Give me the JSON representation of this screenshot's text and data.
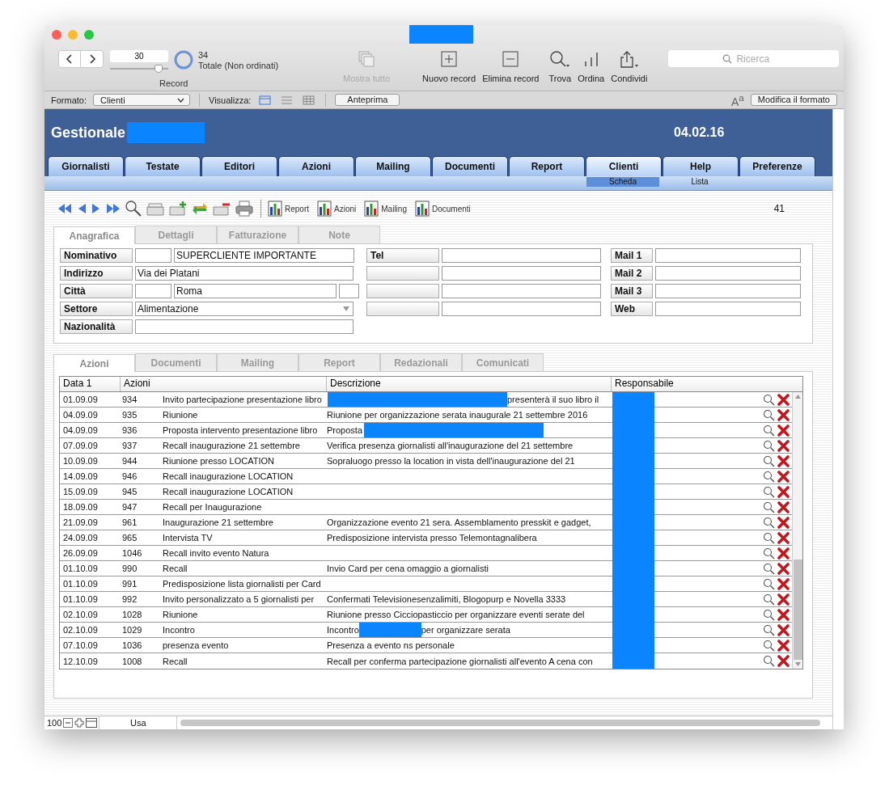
{
  "toolbar": {
    "record_value": "30",
    "record_slider": {
      "level": 0.83
    },
    "record_label": "Record",
    "found_count": "34",
    "found_label": "Totale (Non ordinati)",
    "tools": [
      {
        "kind": "show-all",
        "label": "Mostra tutto",
        "disabled": true
      },
      {
        "kind": "new",
        "label": "Nuovo record",
        "disabled": false
      },
      {
        "kind": "delete",
        "label": "Elimina record",
        "disabled": false
      },
      {
        "kind": "find",
        "label": "Trova",
        "disabled": false
      },
      {
        "kind": "sort",
        "label": "Ordina",
        "disabled": false
      },
      {
        "kind": "share",
        "label": "Condividi",
        "disabled": false
      }
    ],
    "search": {
      "placeholder": "Ricerca"
    }
  },
  "format_bar": {
    "format_label": "Formato:",
    "format_value": "Clienti",
    "view_label": "Visualizza:",
    "views": [
      {
        "kind": "form",
        "selected": true
      },
      {
        "kind": "list",
        "selected": false
      },
      {
        "kind": "table",
        "selected": false
      }
    ],
    "preview_button": "Anteprima",
    "text_size": "A$^{a}$",
    "edit_layout_button": "Modifica il formato"
  },
  "header": {
    "title": "Gestionale",
    "date": "04.02.16"
  },
  "main_tabs": [
    {
      "label": "Giornalisti",
      "selected": false
    },
    {
      "label": "Testate",
      "selected": false
    },
    {
      "label": "Editori",
      "selected": false
    },
    {
      "label": "Azioni",
      "selected": false
    },
    {
      "label": "Mailing",
      "selected": false
    },
    {
      "label": "Documenti",
      "selected": false
    },
    {
      "label": "Report",
      "selected": false
    },
    {
      "label": "Clienti",
      "selected": true
    },
    {
      "label": "Help",
      "selected": false
    },
    {
      "label": "Preferenze",
      "selected": false
    }
  ],
  "sub_tabs": [
    {
      "label": "Scheda",
      "selected": true
    },
    {
      "label": "Lista",
      "selected": false
    }
  ],
  "report_buttons": [
    "Report",
    "Azioni",
    "Mailing",
    "Documenti"
  ],
  "record_number": "41",
  "form_tabs": [
    {
      "label": "Anagrafica",
      "selected": true
    },
    {
      "label": "Dettagli",
      "selected": false
    },
    {
      "label": "Fatturazione",
      "selected": false
    },
    {
      "label": "Note",
      "selected": false
    }
  ],
  "form": {
    "column_1": [
      {
        "label": "Nominativo",
        "inputs": [
          {
            "kind": "code"
          },
          {
            "kind": "main",
            "value": "SUPERCLIENTE IMPORTANTE"
          }
        ]
      },
      {
        "label": "Indirizzo",
        "inputs": [
          {
            "kind": "full",
            "value": "Via dei Platani"
          }
        ]
      },
      {
        "label": "Città",
        "inputs": [
          {
            "kind": "code"
          },
          {
            "kind": "city",
            "value": "Roma"
          },
          {
            "kind": "suffix"
          }
        ]
      },
      {
        "label": "Settore",
        "inputs": [
          {
            "kind": "select",
            "value": "Alimentazione"
          }
        ]
      },
      {
        "label": "Nazionalità",
        "inputs": [
          {
            "kind": "full"
          }
        ]
      }
    ],
    "column_2": [
      {
        "kind": "labeled",
        "label": "Tel"
      },
      {
        "kind": "blank"
      },
      {
        "kind": "blank"
      },
      {
        "kind": "blank"
      }
    ],
    "column_3": [
      {
        "label": "Mail 1"
      },
      {
        "label": "Mail 2"
      },
      {
        "label": "Mail 3"
      },
      {
        "label": "Web"
      }
    ]
  },
  "detail_tabs": [
    {
      "label": "Azioni",
      "selected": true
    },
    {
      "label": "Documenti",
      "selected": false
    },
    {
      "label": "Mailing",
      "selected": false
    },
    {
      "label": "Report",
      "selected": false
    },
    {
      "label": "Redazionali",
      "selected": false
    },
    {
      "label": "Comunicati",
      "selected": false
    }
  ],
  "table": {
    "columns": [
      "Data 1",
      "Azioni",
      "Descrizione",
      "Responsabile"
    ],
    "rows": [
      {
        "date": "01.09.09",
        "number": "934",
        "action": "Invito partecipazione presentazione libro",
        "description_parts": [
          {
            "kind": "redaction"
          },
          {
            "kind": "text",
            "text": "presenterà il suo libro il"
          }
        ]
      },
      {
        "date": "04.09.09",
        "number": "935",
        "action": "Riunione",
        "description": "Riunione per organizzazione serata inaugurale 21 settembre 2016"
      },
      {
        "date": "04.09.09",
        "number": "936",
        "action": "Proposta intervento presentazione libro",
        "description_parts": [
          {
            "kind": "text",
            "text": "Proposta"
          },
          {
            "kind": "redaction"
          }
        ]
      },
      {
        "date": "07.09.09",
        "number": "937",
        "action": "Recall inaugurazione 21 settembre",
        "description": "Verifica presenza giornalisti all'inaugurazione del 21 settembre"
      },
      {
        "date": "10.09.09",
        "number": "944",
        "action": "Riunione presso LOCATION",
        "description": "Sopraluogo presso la location in vista dell'inaugurazione del 21"
      },
      {
        "date": "14.09.09",
        "number": "946",
        "action": "Recall inaugurazione LOCATION"
      },
      {
        "date": "15.09.09",
        "number": "945",
        "action": "Recall inaugurazione LOCATION"
      },
      {
        "date": "18.09.09",
        "number": "947",
        "action": "Recall per Inaugurazione"
      },
      {
        "date": "21.09.09",
        "number": "961",
        "action": "Inaugurazione 21 settembre",
        "description": "Organizzazione evento 21 sera. Assemblamento presskit e gadget,"
      },
      {
        "date": "24.09.09",
        "number": "965",
        "action": "Intervista TV",
        "description": "Predisposizione intervista presso Telemontagnalibera"
      },
      {
        "date": "26.09.09",
        "number": "1046",
        "action": "Recall invito evento Natura"
      },
      {
        "date": "01.10.09",
        "number": "990",
        "action": "Recall",
        "description": "Invio Card per cena omaggio a giornalisti"
      },
      {
        "date": "01.10.09",
        "number": "991",
        "action": "Predisposizione lista giornalisti per Card"
      },
      {
        "date": "01.10.09",
        "number": "992",
        "action": "Invito personalizzato a 5 giornalisti per",
        "description": "Confermati Televisionesenzalimiti, Blogopurp e Novella 3333"
      },
      {
        "date": "02.10.09",
        "number": "1028",
        "action": "Riunione",
        "description": "Riunione presso Cicciopasticcio per organizzare eventi serate del"
      },
      {
        "date": "02.10.09",
        "number": "1029",
        "action": "Incontro",
        "description_parts": [
          {
            "kind": "text",
            "text": "Incontro"
          },
          {
            "kind": "redaction"
          },
          {
            "kind": "text",
            "text": "per organizzare serata"
          }
        ]
      },
      {
        "date": "07.10.09",
        "number": "1036",
        "action": "presenza evento",
        "description": "Presenza a evento ns personale"
      },
      {
        "date": "12.10.09",
        "number": "1008",
        "action": "Recall",
        "description": "Recall per conferma partecipazione giornalisti all'evento A cena con"
      }
    ]
  },
  "status_bar": {
    "zoom": "100",
    "mode": "Usa"
  }
}
